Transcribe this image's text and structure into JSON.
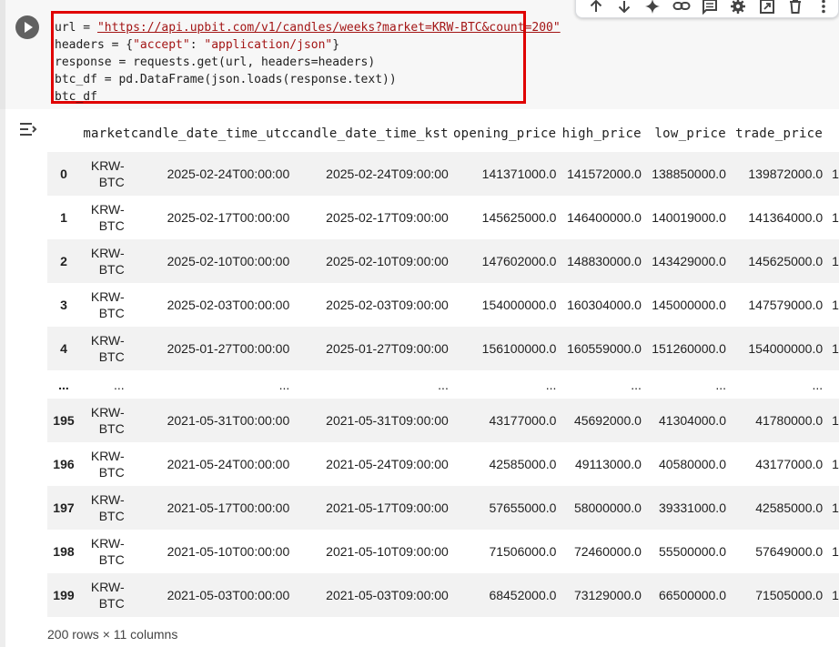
{
  "code": {
    "line1_pre": "url = ",
    "line1_url": "\"https://api.upbit.com/v1/candles/weeks?market=KRW-BTC&count=200\"",
    "line2_pre": "headers = {",
    "line2_key": "\"accept\"",
    "line2_mid": ": ",
    "line2_val": "\"application/json\"",
    "line2_end": "}",
    "line3": "response = requests.get(url, headers=headers)",
    "line4": "btc_df = pd.DataFrame(json.loads(response.text))",
    "line5": "btc_df"
  },
  "toolbar": {
    "icons": [
      "arrow-up-icon",
      "arrow-down-icon",
      "sparkle-icon",
      "link-icon",
      "comment-icon",
      "gear-icon",
      "mirror-cell-icon",
      "trash-icon",
      "more-vert-icon"
    ]
  },
  "table": {
    "columns": [
      "market",
      "candle_date_time_utc",
      "candle_date_time_kst",
      "opening_price",
      "high_price",
      "low_price",
      "trade_price"
    ],
    "rows": [
      {
        "idx": "0",
        "m1": "KRW-",
        "m2": "BTC",
        "utc": "2025-02-24T00:00:00",
        "kst": "2025-02-24T09:00:00",
        "open": "141371000.0",
        "high": "141572000.0",
        "low": "138850000.0",
        "trade": "139872000.0",
        "cut": "1"
      },
      {
        "idx": "1",
        "m1": "KRW-",
        "m2": "BTC",
        "utc": "2025-02-17T00:00:00",
        "kst": "2025-02-17T09:00:00",
        "open": "145625000.0",
        "high": "146400000.0",
        "low": "140019000.0",
        "trade": "141364000.0",
        "cut": "1"
      },
      {
        "idx": "2",
        "m1": "KRW-",
        "m2": "BTC",
        "utc": "2025-02-10T00:00:00",
        "kst": "2025-02-10T09:00:00",
        "open": "147602000.0",
        "high": "148830000.0",
        "low": "143429000.0",
        "trade": "145625000.0",
        "cut": "1"
      },
      {
        "idx": "3",
        "m1": "KRW-",
        "m2": "BTC",
        "utc": "2025-02-03T00:00:00",
        "kst": "2025-02-03T09:00:00",
        "open": "154000000.0",
        "high": "160304000.0",
        "low": "145000000.0",
        "trade": "147579000.0",
        "cut": "1"
      },
      {
        "idx": "4",
        "m1": "KRW-",
        "m2": "BTC",
        "utc": "2025-01-27T00:00:00",
        "kst": "2025-01-27T09:00:00",
        "open": "156100000.0",
        "high": "160559000.0",
        "low": "151260000.0",
        "trade": "154000000.0",
        "cut": "1"
      },
      {
        "idx": "...",
        "m1": "...",
        "m2": "",
        "utc": "...",
        "kst": "...",
        "open": "...",
        "high": "...",
        "low": "...",
        "trade": "...",
        "cut": ""
      },
      {
        "idx": "195",
        "m1": "KRW-",
        "m2": "BTC",
        "utc": "2021-05-31T00:00:00",
        "kst": "2021-05-31T09:00:00",
        "open": "43177000.0",
        "high": "45692000.0",
        "low": "41304000.0",
        "trade": "41780000.0",
        "cut": "1"
      },
      {
        "idx": "196",
        "m1": "KRW-",
        "m2": "BTC",
        "utc": "2021-05-24T00:00:00",
        "kst": "2021-05-24T09:00:00",
        "open": "42585000.0",
        "high": "49113000.0",
        "low": "40580000.0",
        "trade": "43177000.0",
        "cut": "1"
      },
      {
        "idx": "197",
        "m1": "KRW-",
        "m2": "BTC",
        "utc": "2021-05-17T00:00:00",
        "kst": "2021-05-17T09:00:00",
        "open": "57655000.0",
        "high": "58000000.0",
        "low": "39331000.0",
        "trade": "42585000.0",
        "cut": "1"
      },
      {
        "idx": "198",
        "m1": "KRW-",
        "m2": "BTC",
        "utc": "2021-05-10T00:00:00",
        "kst": "2021-05-10T09:00:00",
        "open": "71506000.0",
        "high": "72460000.0",
        "low": "55500000.0",
        "trade": "57649000.0",
        "cut": "1"
      },
      {
        "idx": "199",
        "m1": "KRW-",
        "m2": "BTC",
        "utc": "2021-05-03T00:00:00",
        "kst": "2021-05-03T09:00:00",
        "open": "68452000.0",
        "high": "73129000.0",
        "low": "66500000.0",
        "trade": "71505000.0",
        "cut": "1"
      }
    ],
    "footer": "200 rows × 11 columns"
  },
  "colors": {
    "highlight_border": "#e00000",
    "string": "#a31515",
    "stripe": "#f2f2f2"
  }
}
